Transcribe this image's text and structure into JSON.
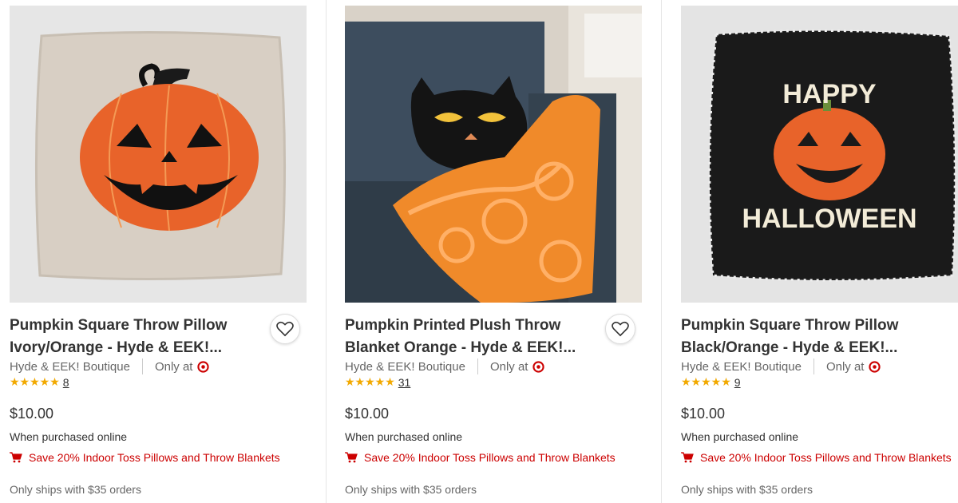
{
  "products": [
    {
      "title_line1": "Pumpkin Square Throw Pillow",
      "title_line2": "Ivory/Orange - Hyde & EEK!...",
      "brand": "Hyde & EEK! Boutique",
      "only_at": "Only at",
      "stars": "★★★★★",
      "rating_value": 5,
      "review_count": "8",
      "price": "$10.00",
      "purchase_note": "When purchased online",
      "promo": "Save 20% Indoor Toss Pillows and Throw Blankets",
      "shipping": "Only ships with $35 orders",
      "image_icon": "pumpkin-pillow-ivory"
    },
    {
      "title_line1": "Pumpkin Printed Plush Throw",
      "title_line2": "Blanket Orange - Hyde & EEK!...",
      "brand": "Hyde & EEK! Boutique",
      "only_at": "Only at",
      "stars": "★★★★★",
      "rating_value": 5,
      "review_count": "31",
      "price": "$10.00",
      "purchase_note": "When purchased online",
      "promo": "Save 20% Indoor Toss Pillows and Throw Blankets",
      "shipping": "Only ships with $35 orders",
      "image_icon": "pumpkin-plush-blanket-on-sofa"
    },
    {
      "title_line1": "Pumpkin Square Throw Pillow",
      "title_line2": "Black/Orange - Hyde & EEK!...",
      "brand": "Hyde & EEK! Boutique",
      "only_at": "Only at",
      "stars": "★★★★★",
      "rating_value": 5,
      "review_count": "9",
      "price": "$10.00",
      "purchase_note": "When purchased online",
      "promo": "Save 20% Indoor Toss Pillows and Throw Blankets",
      "shipping": "Only ships with $35 orders",
      "image_icon": "happy-halloween-pillow-black",
      "image_text_top": "HAPPY",
      "image_text_bottom": "HALLOWEEN"
    }
  ],
  "colors": {
    "promo_red": "#cc0000",
    "star_gold": "#f2a900",
    "target_red": "#cc0000",
    "pumpkin_orange": "#e8632a"
  }
}
